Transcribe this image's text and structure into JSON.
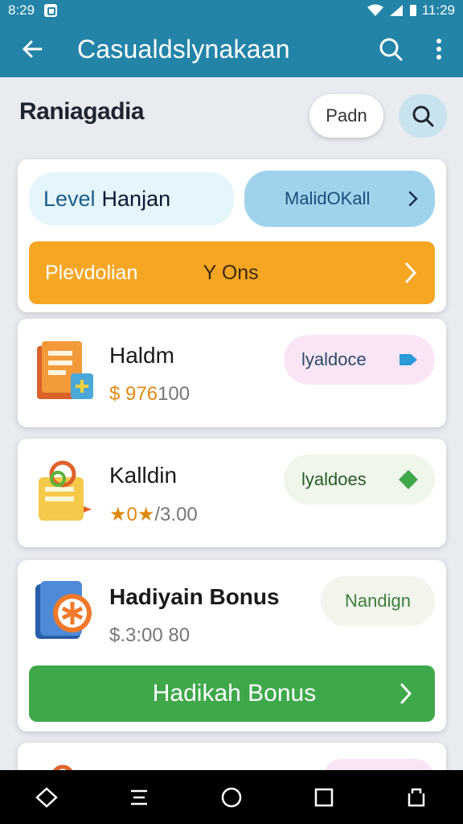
{
  "status": {
    "left_time": "8:29",
    "right_time": "11:29"
  },
  "app_bar": {
    "title": "Casualdslynakaan"
  },
  "header": {
    "section_title": "Raniagadia",
    "pill_label": "Padn"
  },
  "top_card": {
    "level_label": "Level",
    "level_value": "Hanjan",
    "right_pill_label": "MalidOKall",
    "orange_left": "Plevdolian",
    "orange_mid": "Y Ons"
  },
  "items": [
    {
      "name": "Haldm",
      "price_highlight": "$ 976",
      "price_rest": "100",
      "tag": "lyaldoce",
      "tag_color": "#fae5f6"
    },
    {
      "name": "Kalldin",
      "price_highlight": "★0★",
      "price_rest": "/3.00",
      "tag": "lyaldoes",
      "tag_color": "#eff6ea"
    },
    {
      "name": "Hadiyain Bonus",
      "price_highlight": "",
      "price_rest": "$.3:00 80",
      "tag": "Nandign",
      "tag_color": "#f1f5ec"
    }
  ],
  "bonus_button": {
    "label": "Hadikah Bonus"
  },
  "colors": {
    "primary": "#2384a8",
    "orange": "#f5a623",
    "green": "#3fa84a"
  }
}
